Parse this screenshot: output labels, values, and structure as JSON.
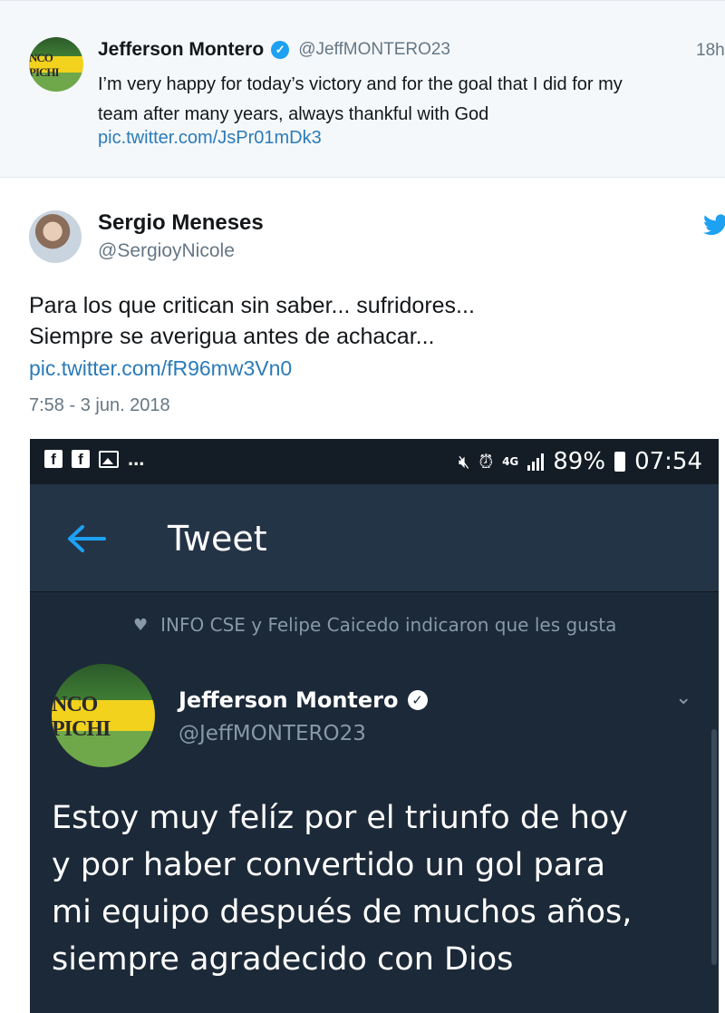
{
  "quoted_tweet": {
    "name": "Jefferson Montero",
    "handle": "@JeffMONTERO23",
    "time": "18h",
    "text_line1": "I’m very happy for today’s victory and for the goal that I did for my",
    "text_line2": "team after many years, always thankful with God",
    "link": "pic.twitter.com/JsPr01mDk3",
    "avatar_text": "NCO PICHI",
    "verified_icon": "verified-badge-icon"
  },
  "main_tweet": {
    "name": "Sergio Meneses",
    "handle": "@SergioyNicole",
    "text_line1": "Para los que critican sin saber... sufridores...",
    "text_line2": "Siempre se averigua antes de achacar...",
    "link": "pic.twitter.com/fR96mw3Vn0",
    "timestamp": "7:58 - 3 jun. 2018"
  },
  "screenshot": {
    "status_bar": {
      "left_icons": [
        "facebook-icon",
        "facebook-icon",
        "image-icon"
      ],
      "dots": "...",
      "battery": "89%",
      "time": "07:54",
      "network": "4G"
    },
    "app_title": "Tweet",
    "liked_by": "INFO CSE y Felipe Caicedo indicaron que les gusta",
    "author_name": "Jefferson Montero",
    "author_handle": "@JeffMONTERO23",
    "avatar_text": "NCO PICHI",
    "text_line1": "Estoy muy felíz por el triunfo de hoy",
    "text_line2": "y por haber convertido un gol para",
    "text_line3": "mi equipo después de muchos años,",
    "text_line4": "siempre agradecido con Dios"
  },
  "colors": {
    "link": "#2b7bb9",
    "twitter_blue": "#1da1f2",
    "dark_bg": "#1c2938"
  }
}
